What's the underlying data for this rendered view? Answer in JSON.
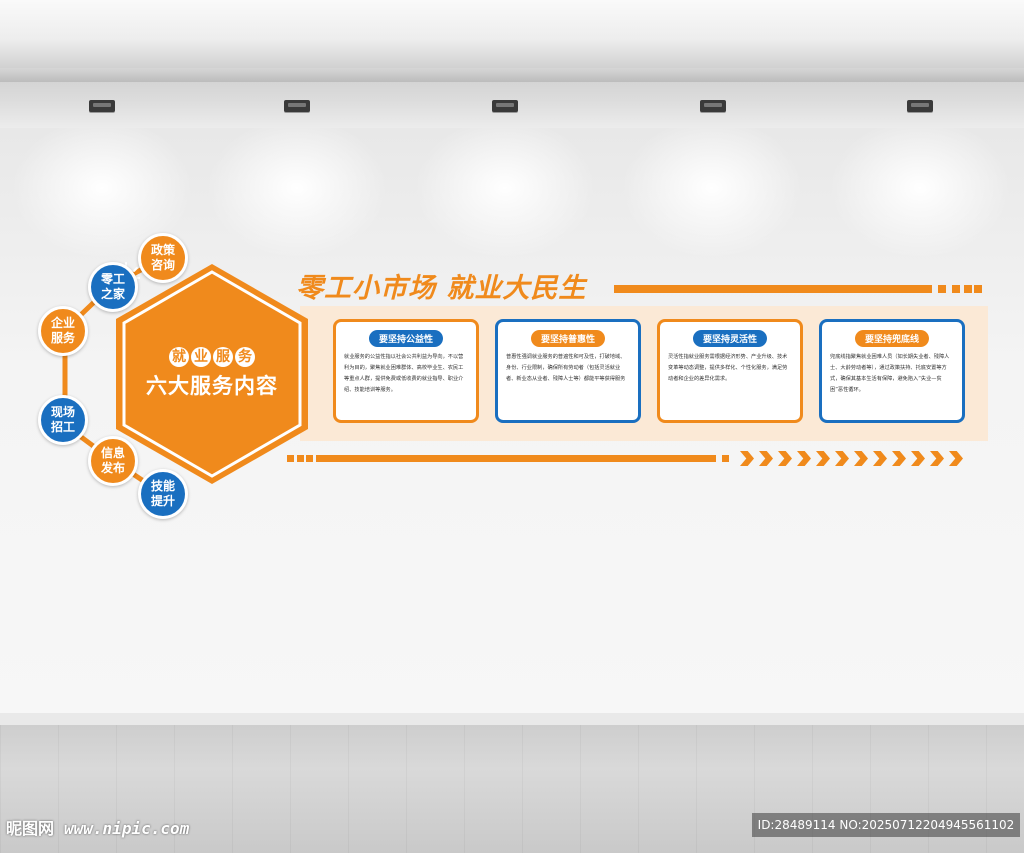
{
  "scene": {
    "title": "零工小市场  就业大民生"
  },
  "hexagon": {
    "subtitle_chars": [
      "就",
      "业",
      "服",
      "务"
    ],
    "main": "六大服务内容",
    "icon": "lightbulb-icon"
  },
  "nodes": [
    {
      "label": "政策咨询",
      "color": "orange"
    },
    {
      "label": "零工之家",
      "color": "blue"
    },
    {
      "label": "企业服务",
      "color": "orange"
    },
    {
      "label": "现场招工",
      "color": "blue"
    },
    {
      "label": "信息发布",
      "color": "orange"
    },
    {
      "label": "技能提升",
      "color": "blue"
    }
  ],
  "cards": [
    {
      "header": "要坚持公益性",
      "body": "就业服务的公益性指以社会公共利益为导向，不以营利为目的，聚焦就业困难群体、高校毕业生、农民工等重点人群，提供免费或低收费的就业指导、职业介绍、技能培训等服务。"
    },
    {
      "header": "要坚持普惠性",
      "body": "普惠性强调就业服务的普遍性和可及性，打破地域、身份、行业限制，确保所有劳动者（包括灵活就业者、新业态从业者、残障人士等）都能平等获得服务"
    },
    {
      "header": "要坚持灵活性",
      "body": "灵活性指就业服务需根据经济形势、产业升级、技术变革等动态调整，提供多样化、个性化服务，满足劳动者和企业的差异化需求。"
    },
    {
      "header": "要坚持兜底线",
      "body": "兜底线指聚焦就业困难人员（如长期失业者、残障人士、大龄劳动者等），通过政策扶持、托底安置等方式，确保其基本生活有保障，避免陷入“失业—贫困”恶性循环。"
    }
  ],
  "watermark": {
    "site": "昵图网",
    "url": "www.nipic.com",
    "id": "ID:28489114 NO:20250712204945561102"
  },
  "colors": {
    "orange": "#f08a1c",
    "blue": "#1a6fc0",
    "panel": "#fbe9d6"
  }
}
